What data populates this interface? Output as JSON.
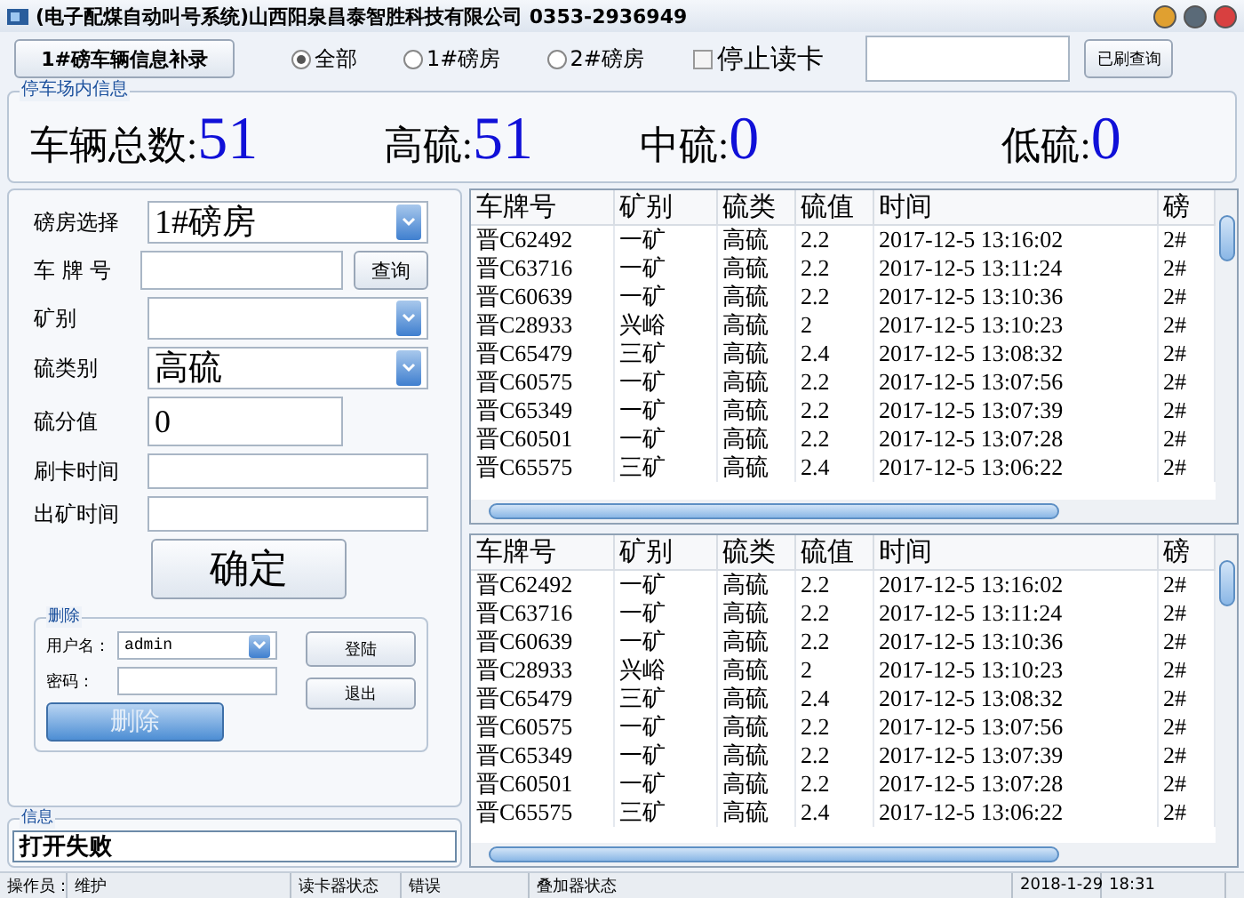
{
  "window": {
    "title": "(电子配煤自动叫号系统)山西阳泉昌泰智胜科技有限公司  0353-2936949"
  },
  "toolbar": {
    "supplement_button": "1#磅车辆信息补录",
    "radios": [
      {
        "label": "全部",
        "selected": true
      },
      {
        "label": "1#磅房",
        "selected": false
      },
      {
        "label": "2#磅房",
        "selected": false
      }
    ],
    "stop_reading": {
      "label": "停止读卡",
      "checked": false
    },
    "swiped_query_button": "已刷查询"
  },
  "parking_info": {
    "legend": "停车场内信息",
    "stats": [
      {
        "label": "车辆总数:",
        "value": "51"
      },
      {
        "label": "高硫:",
        "value": "51"
      },
      {
        "label": "中硫:",
        "value": "0"
      },
      {
        "label": "低硫:",
        "value": "0"
      }
    ]
  },
  "form": {
    "fields": [
      {
        "kind": "select",
        "label": "磅房选择",
        "value": "1#磅房"
      },
      {
        "kind": "text_button",
        "label": "车 牌 号",
        "button": "查询"
      },
      {
        "kind": "select",
        "label": "矿别"
      },
      {
        "kind": "select",
        "label": "硫类别",
        "value": "高硫"
      },
      {
        "kind": "short_text",
        "label": "硫分值",
        "value": "0"
      },
      {
        "kind": "text",
        "label": "刷卡时间"
      },
      {
        "kind": "text",
        "label": "出矿时间"
      }
    ],
    "confirm_button": "确定"
  },
  "delete_group": {
    "legend": "删除",
    "username_label": "用户名：",
    "username": "admin",
    "password_label": "密码：",
    "login_button": "登陆",
    "exit_button": "退出",
    "delete_button": "删除",
    "delete_disabled": true
  },
  "info_group": {
    "legend": "信息",
    "message": "打开失败"
  },
  "tables": [
    {
      "columns": [
        "车牌号",
        "矿别",
        "硫类",
        "硫值",
        "时间",
        "磅"
      ],
      "rows": [
        [
          "晋C62492",
          "一矿",
          "高硫",
          "2.2",
          "2017-12-5  13:16:02",
          "2#"
        ],
        [
          "晋C63716",
          "一矿",
          "高硫",
          "2.2",
          "2017-12-5  13:11:24",
          "2#"
        ],
        [
          "晋C60639",
          "一矿",
          "高硫",
          "2.2",
          "2017-12-5  13:10:36",
          "2#"
        ],
        [
          "晋C28933",
          "兴峪",
          "高硫",
          "2",
          "2017-12-5  13:10:23",
          "2#"
        ],
        [
          "晋C65479",
          "三矿",
          "高硫",
          "2.4",
          "2017-12-5  13:08:32",
          "2#"
        ],
        [
          "晋C60575",
          "一矿",
          "高硫",
          "2.2",
          "2017-12-5  13:07:56",
          "2#"
        ],
        [
          "晋C65349",
          "一矿",
          "高硫",
          "2.2",
          "2017-12-5  13:07:39",
          "2#"
        ],
        [
          "晋C60501",
          "一矿",
          "高硫",
          "2.2",
          "2017-12-5  13:07:28",
          "2#"
        ],
        [
          "晋C65575",
          "三矿",
          "高硫",
          "2.4",
          "2017-12-5  13:06:22",
          "2#"
        ]
      ]
    },
    {
      "columns": [
        "车牌号",
        "矿别",
        "硫类",
        "硫值",
        "时间",
        "磅"
      ],
      "rows": [
        [
          "晋C62492",
          "一矿",
          "高硫",
          "2.2",
          "2017-12-5  13:16:02",
          "2#"
        ],
        [
          "晋C63716",
          "一矿",
          "高硫",
          "2.2",
          "2017-12-5  13:11:24",
          "2#"
        ],
        [
          "晋C60639",
          "一矿",
          "高硫",
          "2.2",
          "2017-12-5  13:10:36",
          "2#"
        ],
        [
          "晋C28933",
          "兴峪",
          "高硫",
          "2",
          "2017-12-5  13:10:23",
          "2#"
        ],
        [
          "晋C65479",
          "三矿",
          "高硫",
          "2.4",
          "2017-12-5  13:08:32",
          "2#"
        ],
        [
          "晋C60575",
          "一矿",
          "高硫",
          "2.2",
          "2017-12-5  13:07:56",
          "2#"
        ],
        [
          "晋C65349",
          "一矿",
          "高硫",
          "2.2",
          "2017-12-5  13:07:39",
          "2#"
        ],
        [
          "晋C60501",
          "一矿",
          "高硫",
          "2.2",
          "2017-12-5  13:07:28",
          "2#"
        ],
        [
          "晋C65575",
          "三矿",
          "高硫",
          "2.4",
          "2017-12-5  13:06:22",
          "2#"
        ]
      ]
    }
  ],
  "status_bar": [
    "操作员：",
    "维护",
    "读卡器状态",
    "错误",
    "叠加器状态",
    "2018-1-29",
    "18:31"
  ]
}
